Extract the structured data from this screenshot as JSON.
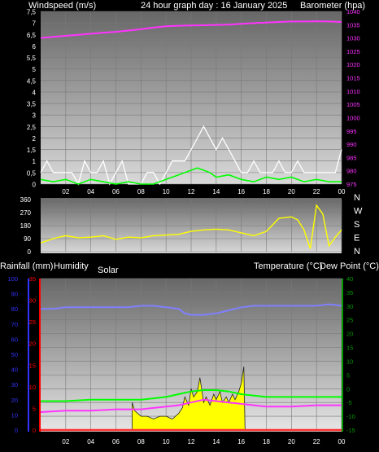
{
  "header": {
    "left_title": "Windspeed (m/s)",
    "center_title": "24 hour graph day : 16 January 2025",
    "right_title": "Barometer (hpa)"
  },
  "colors": {
    "background": "#000000",
    "plot_top": "#676767",
    "plot_bottom": "#d9d9d9",
    "grid": "#7a7a7a",
    "wind_speed": "#ffffff",
    "wind_avg": "#00ff00",
    "barometer": "#ff33ff",
    "direction": "#ffff00",
    "temperature": "#ff33ff",
    "dew_point": "#00ff00",
    "humidity": "#8080ff",
    "rain": "#ff3030",
    "solar": "#ffff00",
    "rain_axis": "#ff0000",
    "humidity_axis": "#3333ff",
    "temp_axis": "#009900"
  },
  "x_axis": {
    "tick_labels": [
      "02",
      "04",
      "06",
      "08",
      "10",
      "12",
      "14",
      "16",
      "18",
      "20",
      "22",
      "00"
    ]
  },
  "chart_data": [
    {
      "type": "line",
      "panel": "wind_barometer",
      "title": "24 hour graph day : 16 January 2025",
      "x_unit": "hour",
      "xlim": [
        0,
        24
      ],
      "left_axis": {
        "label": "Windspeed (m/s)",
        "range": [
          0,
          7.5
        ],
        "ticks": [
          "0",
          "0,5",
          "1",
          "1,5",
          "2",
          "2,5",
          "3",
          "3,5",
          "4",
          "4,5",
          "5",
          "5,5",
          "6",
          "6,5",
          "7",
          "7,5"
        ]
      },
      "right_axis": {
        "label": "Barometer (hpa)",
        "range": [
          975,
          1040
        ],
        "ticks": [
          "975",
          "980",
          "985",
          "990",
          "995",
          "1000",
          "1005",
          "1010",
          "1015",
          "1020",
          "1025",
          "1030",
          "1035",
          "1040"
        ]
      },
      "series": [
        {
          "axis": "left",
          "x": [
            0,
            0.5,
            1,
            1.5,
            2,
            2.5,
            3,
            3.5,
            4,
            4.5,
            5,
            5.5,
            6,
            6.5,
            7,
            7.5,
            8,
            8.5,
            9,
            9.5,
            10,
            10.5,
            11,
            11.5,
            12,
            12.5,
            13,
            13.5,
            14,
            14.5,
            15,
            15.5,
            16,
            16.5,
            17,
            17.5,
            18,
            18.5,
            19,
            19.5,
            20,
            20.5,
            21,
            21.5,
            22,
            22.5,
            23,
            23.5,
            24
          ],
          "values": [
            0.5,
            1.0,
            0.5,
            0.5,
            0.5,
            0.5,
            0.0,
            1.0,
            0.5,
            0.5,
            1.0,
            0.0,
            0.5,
            1.0,
            0.0,
            0.0,
            0.0,
            0.5,
            0.5,
            0.0,
            0.5,
            1.0,
            1.0,
            1.0,
            1.5,
            2.0,
            2.5,
            2.0,
            1.5,
            2.0,
            1.5,
            1.0,
            0.5,
            0.5,
            1.0,
            0.5,
            0.5,
            0.5,
            1.0,
            0.5,
            0.5,
            1.0,
            0.5,
            0.5,
            0.5,
            0.5,
            0.5,
            0.5,
            1.5
          ]
        },
        {
          "axis": "left",
          "x": [
            0,
            1,
            2,
            3,
            4,
            5,
            6,
            7,
            8,
            9,
            10,
            11,
            12,
            12.5,
            13,
            13.5,
            14,
            15,
            16,
            17,
            18,
            19,
            20,
            21,
            22,
            23,
            24
          ],
          "values": [
            0.2,
            0.1,
            0.2,
            0.0,
            0.2,
            0.1,
            0.0,
            0.1,
            0.0,
            0.0,
            0.2,
            0.4,
            0.6,
            0.7,
            0.6,
            0.5,
            0.3,
            0.4,
            0.2,
            0.1,
            0.3,
            0.2,
            0.3,
            0.1,
            0.2,
            0.1,
            0.1
          ]
        },
        {
          "axis": "right",
          "x": [
            0,
            1,
            2,
            3,
            4,
            5,
            6,
            7,
            8,
            9,
            10,
            11,
            12,
            13,
            14,
            15,
            16,
            17,
            18,
            19,
            20,
            21,
            22,
            23,
            24
          ],
          "values": [
            1030.0,
            1030.4,
            1030.8,
            1031.2,
            1031.6,
            1032.0,
            1032.3,
            1032.8,
            1033.3,
            1033.9,
            1034.4,
            1034.6,
            1034.7,
            1034.8,
            1034.9,
            1035.0,
            1035.3,
            1035.6,
            1035.8,
            1036.0,
            1036.2,
            1036.2,
            1036.3,
            1036.2,
            1036.0
          ]
        }
      ]
    },
    {
      "type": "line",
      "panel": "wind_direction",
      "xlim": [
        0,
        24
      ],
      "left_axis": {
        "range": [
          0,
          360
        ],
        "ticks": [
          "0",
          "90",
          "180",
          "270",
          "360"
        ]
      },
      "right_labels": [
        "N",
        "W",
        "S",
        "E",
        "N"
      ],
      "series": [
        {
          "x": [
            0,
            1,
            2,
            3,
            4,
            5,
            6,
            7,
            8,
            9,
            10,
            11,
            12,
            13,
            14,
            15,
            16,
            17,
            18,
            19,
            20,
            20.5,
            21,
            21.5,
            22,
            22.5,
            23,
            23.5,
            24
          ],
          "values": [
            60,
            90,
            110,
            95,
            100,
            110,
            85,
            100,
            95,
            110,
            115,
            120,
            140,
            150,
            155,
            150,
            130,
            110,
            140,
            230,
            240,
            220,
            150,
            20,
            320,
            260,
            40,
            100,
            150
          ]
        }
      ]
    },
    {
      "type": "line",
      "panel": "temperature_humidity",
      "labels": {
        "rain": "Rainfall (mm)",
        "humidity": "Humidity",
        "solar": "Solar",
        "temperature": "Temperature (°C)",
        "dew_point": "Dew Point (°C)"
      },
      "xlim": [
        0,
        24
      ],
      "humidity_axis": {
        "range": [
          0,
          100
        ],
        "ticks": [
          "0",
          "10",
          "20",
          "30",
          "40",
          "50",
          "60",
          "70",
          "80",
          "90",
          "100"
        ]
      },
      "rain_axis": {
        "range": [
          0,
          35
        ],
        "ticks": [
          "0",
          "5",
          "10",
          "15",
          "20",
          "25",
          "30",
          "35"
        ]
      },
      "temp_axis": {
        "range": [
          -15,
          40
        ],
        "ticks": [
          "-15",
          "-10",
          "-5",
          "0",
          "5",
          "10",
          "15",
          "20",
          "25",
          "30",
          "35",
          "40"
        ]
      },
      "series": [
        {
          "axis": "humidity",
          "x": [
            0,
            1,
            2,
            3,
            4,
            5,
            6,
            7,
            8,
            9,
            10,
            11,
            11.5,
            12,
            13,
            14,
            15,
            16,
            17,
            18,
            19,
            20,
            21,
            22,
            23,
            24
          ],
          "values": [
            80,
            80,
            81,
            81,
            81,
            81,
            81,
            81,
            82,
            82,
            81,
            80,
            77,
            76,
            76,
            77,
            79,
            81,
            82,
            82,
            82,
            82,
            82,
            82,
            83,
            82
          ]
        },
        {
          "axis": "temp",
          "x": [
            0,
            2,
            4,
            6,
            8,
            9,
            10,
            11,
            12,
            13,
            14,
            15,
            16,
            17,
            18,
            20,
            22,
            24
          ],
          "values": [
            -4.5,
            -4.5,
            -4.0,
            -4.0,
            -4.0,
            -3.5,
            -3.0,
            -2.0,
            -1.0,
            -0.5,
            -0.5,
            -1.0,
            -2.0,
            -2.5,
            -3.0,
            -3.0,
            -3.0,
            -3.0
          ]
        },
        {
          "axis": "temp",
          "x": [
            0,
            2,
            4,
            6,
            8,
            9,
            10,
            11,
            12,
            13,
            14,
            15,
            16,
            17,
            18,
            20,
            22,
            24
          ],
          "values": [
            -8.5,
            -8.0,
            -8.0,
            -7.5,
            -7.5,
            -7.0,
            -6.5,
            -6.0,
            -5.0,
            -4.0,
            -4.5,
            -5.0,
            -5.5,
            -6.0,
            -6.5,
            -6.5,
            -6.0,
            -6.0
          ]
        },
        {
          "axis": "temp",
          "x": [
            0,
            24
          ],
          "values": [
            -15,
            -15
          ]
        },
        {
          "type": "area",
          "axis": "temp",
          "x": [
            7.3,
            7.5,
            8,
            8.5,
            9,
            9.5,
            10,
            10.5,
            11,
            11.3,
            11.5,
            11.8,
            12,
            12.2,
            12.5,
            12.7,
            13,
            13.2,
            13.5,
            13.8,
            14,
            14.3,
            14.5,
            14.8,
            15,
            15.3,
            15.5,
            15.8,
            16,
            16.2,
            16.3
          ],
          "values": [
            -5,
            -8,
            -10,
            -10,
            -11,
            -10,
            -10,
            -11,
            -9,
            -7,
            -3,
            -6,
            0,
            -3,
            -1,
            4,
            -5,
            -3,
            -6,
            -2,
            -4,
            -1,
            -5,
            -3,
            -5,
            -2,
            -4,
            -1,
            2,
            8,
            -15
          ]
        }
      ]
    }
  ]
}
